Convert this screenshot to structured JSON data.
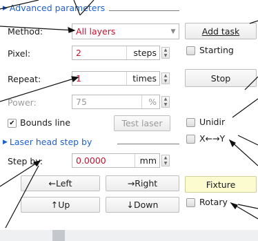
{
  "advanced": {
    "title": "Advanced parameters",
    "method": {
      "label": "Method:",
      "value": "All layers"
    },
    "pixel": {
      "label": "Pixel:",
      "value": "2",
      "unit": "steps"
    },
    "repeat": {
      "label": "Repeat:",
      "value": "1",
      "unit": "times"
    },
    "power": {
      "label": "Power:",
      "value": "75",
      "unit": "%"
    },
    "bounds_line": {
      "label": "Bounds line",
      "checked": true
    },
    "test_laser_label": "Test laser"
  },
  "right": {
    "add_task_label": "Add task",
    "starting": {
      "label": "Starting",
      "checked": false
    },
    "stop_label": "Stop",
    "unidir": {
      "label": "Unidir",
      "checked": false
    },
    "xy": {
      "label": "X←→Y",
      "checked": false
    },
    "fixture_label": "Fixture",
    "rotary": {
      "label": "Rotary",
      "checked": false
    }
  },
  "laser_head": {
    "title": "Laser head step by",
    "step_by": {
      "label": "Step by:",
      "value": "0.0000",
      "unit": "mm"
    },
    "left_label": "←Left",
    "right_label": "→Right",
    "up_label": "↑Up",
    "down_label": "↓Down"
  },
  "colors": {
    "accent_blue": "#1f5fcf",
    "value_red": "#c8102e",
    "fixture_bg": "#fbfbcf"
  },
  "icons": {
    "dropdown": "chevron-down-icon",
    "checkmark": "checkmark-icon",
    "spin": "spin-up-down-icon"
  }
}
